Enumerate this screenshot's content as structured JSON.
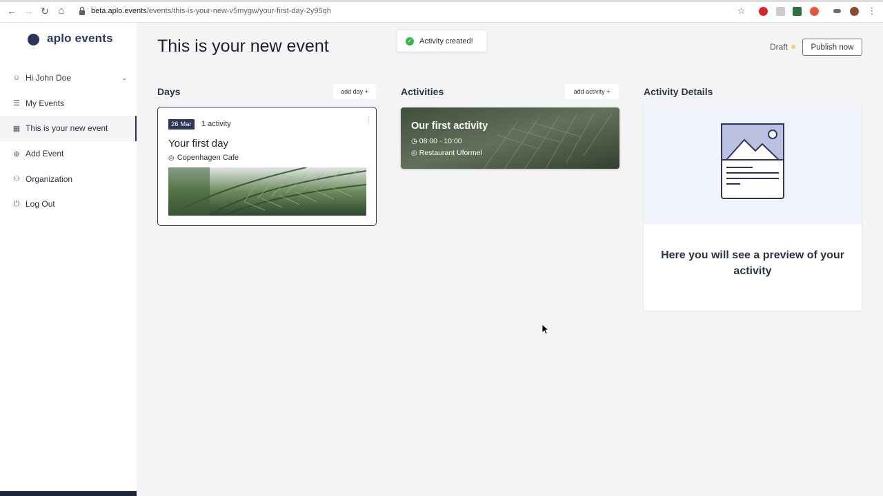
{
  "browser": {
    "url_host": "beta.aplo.events",
    "url_path": "/events/this-is-your-new-v5mygw/your-first-day-2y95qh",
    "back_icon": "←",
    "forward_icon": "→",
    "reload_icon": "↻",
    "home_icon": "⌂",
    "star_icon": "☆"
  },
  "sidebar": {
    "logo_text": "aplo events",
    "items": [
      {
        "label": "Hi John Doe",
        "icon": "☺"
      },
      {
        "label": "My Events",
        "icon": "☰"
      },
      {
        "label": "This is your new event",
        "icon": "▦"
      },
      {
        "label": "Add Event",
        "icon": "⊕"
      },
      {
        "label": "Organization",
        "icon": "⚇"
      },
      {
        "label": "Log Out",
        "icon": "⏻"
      }
    ],
    "user_chevron": "⌄"
  },
  "header": {
    "title": "This is your new event",
    "toast": "Activity created!",
    "toast_icon": "✓",
    "status": "Draft",
    "publish_label": "Publish now"
  },
  "days": {
    "title": "Days",
    "add_label": "add day +",
    "card": {
      "date": "26 Mar",
      "count": "1 activity",
      "title": "Your first day",
      "location": "Copenhagen Cafe",
      "kebab": "⋮",
      "pin_icon": "◎"
    }
  },
  "activities": {
    "title": "Activities",
    "add_label": "add activity +",
    "card": {
      "title": "Our first activity",
      "time": "08:00 - 10:00",
      "location": "Restaurant Uformel",
      "clock_icon": "◷",
      "pin_icon": "◎"
    }
  },
  "details": {
    "title": "Activity Details",
    "placeholder": "Here you will see a preview of your activity"
  },
  "colors": {
    "brand": "#2d3559",
    "success": "#3bb54a",
    "draft": "#f3d35c"
  }
}
